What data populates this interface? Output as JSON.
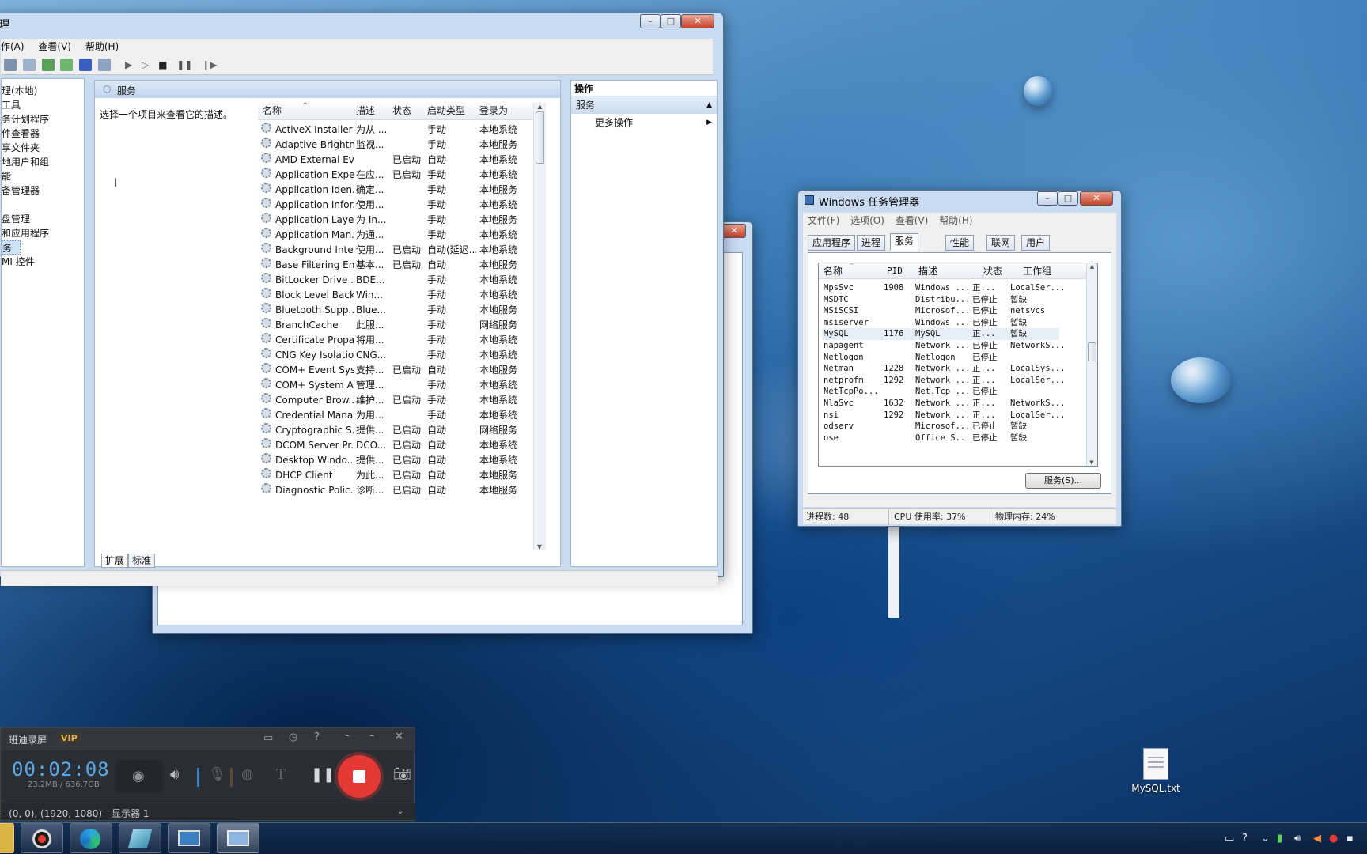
{
  "services_window": {
    "title_fragment": "理",
    "menu": [
      "作(A)",
      "查看(V)",
      "帮助(H)"
    ],
    "tree": [
      "理(本地)",
      "工具",
      "务计划程序",
      "件查看器",
      "享文件夹",
      "地用户和组",
      "能",
      "备管理器",
      "",
      "盘管理",
      "和应用程序",
      "务",
      "MI 控件"
    ],
    "header_title": "服务",
    "description_placeholder": "选择一个项目来查看它的描述。",
    "columns": [
      "名称",
      "描述",
      "状态",
      "启动类型",
      "登录为"
    ],
    "rows": [
      {
        "name": "ActiveX Installer ...",
        "desc": "为从 ...",
        "status": "",
        "startup": "手动",
        "logon": "本地系统"
      },
      {
        "name": "Adaptive Brightn...",
        "desc": "监视...",
        "status": "",
        "startup": "手动",
        "logon": "本地服务"
      },
      {
        "name": "AMD External Ev...",
        "desc": "",
        "status": "已启动",
        "startup": "自动",
        "logon": "本地系统"
      },
      {
        "name": "Application Expe...",
        "desc": "在应...",
        "status": "已启动",
        "startup": "手动",
        "logon": "本地系统"
      },
      {
        "name": "Application Iden...",
        "desc": "确定...",
        "status": "",
        "startup": "手动",
        "logon": "本地服务"
      },
      {
        "name": "Application Infor...",
        "desc": "使用...",
        "status": "",
        "startup": "手动",
        "logon": "本地系统"
      },
      {
        "name": "Application Laye...",
        "desc": "为 In...",
        "status": "",
        "startup": "手动",
        "logon": "本地服务"
      },
      {
        "name": "Application Man...",
        "desc": "为通...",
        "status": "",
        "startup": "手动",
        "logon": "本地系统"
      },
      {
        "name": "Background Inte...",
        "desc": "使用...",
        "status": "已启动",
        "startup": "自动(延迟...",
        "logon": "本地系统"
      },
      {
        "name": "Base Filtering En...",
        "desc": "基本...",
        "status": "已启动",
        "startup": "自动",
        "logon": "本地服务"
      },
      {
        "name": "BitLocker Drive ...",
        "desc": "BDE...",
        "status": "",
        "startup": "手动",
        "logon": "本地系统"
      },
      {
        "name": "Block Level Back...",
        "desc": "Win...",
        "status": "",
        "startup": "手动",
        "logon": "本地系统"
      },
      {
        "name": "Bluetooth Supp...",
        "desc": "Blue...",
        "status": "",
        "startup": "手动",
        "logon": "本地服务"
      },
      {
        "name": "BranchCache",
        "desc": "此服...",
        "status": "",
        "startup": "手动",
        "logon": "网络服务"
      },
      {
        "name": "Certificate Propa...",
        "desc": "将用...",
        "status": "",
        "startup": "手动",
        "logon": "本地系统"
      },
      {
        "name": "CNG Key Isolation",
        "desc": "CNG...",
        "status": "",
        "startup": "手动",
        "logon": "本地系统"
      },
      {
        "name": "COM+ Event Sys...",
        "desc": "支持...",
        "status": "已启动",
        "startup": "自动",
        "logon": "本地服务"
      },
      {
        "name": "COM+ System A...",
        "desc": "管理...",
        "status": "",
        "startup": "手动",
        "logon": "本地系统"
      },
      {
        "name": "Computer Brow...",
        "desc": "维护...",
        "status": "已启动",
        "startup": "手动",
        "logon": "本地系统"
      },
      {
        "name": "Credential Mana...",
        "desc": "为用...",
        "status": "",
        "startup": "手动",
        "logon": "本地系统"
      },
      {
        "name": "Cryptographic S...",
        "desc": "提供...",
        "status": "已启动",
        "startup": "自动",
        "logon": "网络服务"
      },
      {
        "name": "DCOM Server Pr...",
        "desc": "DCO...",
        "status": "已启动",
        "startup": "自动",
        "logon": "本地系统"
      },
      {
        "name": "Desktop Windo...",
        "desc": "提供...",
        "status": "已启动",
        "startup": "自动",
        "logon": "本地系统"
      },
      {
        "name": "DHCP Client",
        "desc": "为此...",
        "status": "已启动",
        "startup": "自动",
        "logon": "本地服务"
      },
      {
        "name": "Diagnostic Polic...",
        "desc": "诊断...",
        "status": "已启动",
        "startup": "自动",
        "logon": "本地服务"
      }
    ],
    "tabs": [
      "扩展",
      "标准"
    ],
    "actions_title": "操作",
    "actions_section": "服务",
    "actions_more": "更多操作"
  },
  "task_manager": {
    "title": "Windows 任务管理器",
    "menu": [
      "文件(F)",
      "选项(O)",
      "查看(V)",
      "帮助(H)"
    ],
    "tabs": [
      "应用程序",
      "进程",
      "服务",
      "性能",
      "联网",
      "用户"
    ],
    "active_tab": "服务",
    "columns": [
      "名称",
      "PID",
      "描述",
      "状态",
      "工作组"
    ],
    "rows": [
      {
        "name": "MpsSvc",
        "pid": "1908",
        "desc": "Windows ...",
        "status": "正...",
        "group": "LocalSer..."
      },
      {
        "name": "MSDTC",
        "pid": "",
        "desc": "Distribu...",
        "status": "已停止",
        "group": "暂缺"
      },
      {
        "name": "MSiSCSI",
        "pid": "",
        "desc": "Microsof...",
        "status": "已停止",
        "group": "netsvcs"
      },
      {
        "name": "msiserver",
        "pid": "",
        "desc": "Windows ...",
        "status": "已停止",
        "group": "暂缺"
      },
      {
        "name": "MySQL",
        "pid": "1176",
        "desc": "MySQL",
        "status": "正...",
        "group": "暂缺"
      },
      {
        "name": "napagent",
        "pid": "",
        "desc": "Network ...",
        "status": "已停止",
        "group": "NetworkS..."
      },
      {
        "name": "Netlogon",
        "pid": "",
        "desc": "Netlogon",
        "status": "已停止",
        "group": ""
      },
      {
        "name": "Netman",
        "pid": "1228",
        "desc": "Network ...",
        "status": "正...",
        "group": "LocalSys..."
      },
      {
        "name": "netprofm",
        "pid": "1292",
        "desc": "Network ...",
        "status": "正...",
        "group": "LocalSer..."
      },
      {
        "name": "NetTcpPo...",
        "pid": "",
        "desc": "Net.Tcp ...",
        "status": "已停止",
        "group": ""
      },
      {
        "name": "NlaSvc",
        "pid": "1632",
        "desc": "Network ...",
        "status": "正...",
        "group": "NetworkS..."
      },
      {
        "name": "nsi",
        "pid": "1292",
        "desc": "Network ...",
        "status": "正...",
        "group": "LocalSer..."
      },
      {
        "name": "odserv",
        "pid": "",
        "desc": "Microsof...",
        "status": "已停止",
        "group": "暂缺"
      },
      {
        "name": "ose",
        "pid": "",
        "desc": "Office S...",
        "status": "已停止",
        "group": "暂缺"
      }
    ],
    "selected_row": "MySQL",
    "services_button": "服务(S)...",
    "status": {
      "processes": "进程数: 48",
      "cpu": "CPU 使用率: 37%",
      "memory": "物理内存: 24%"
    }
  },
  "recorder": {
    "brand": "班迪录屏",
    "vip": "VIP",
    "timer": "00:02:08",
    "storage": "23.2MB / 636.7GB",
    "target": "- (0, 0), (1920, 1080) - 显示器 1"
  },
  "desktop": {
    "file_label": "MySQL.txt"
  },
  "colors": {
    "recorder_bg": "#2a2d33",
    "record_stop": "#e53935",
    "timer_blue": "#5aa9e6",
    "vip_gold": "#e0b24a"
  }
}
